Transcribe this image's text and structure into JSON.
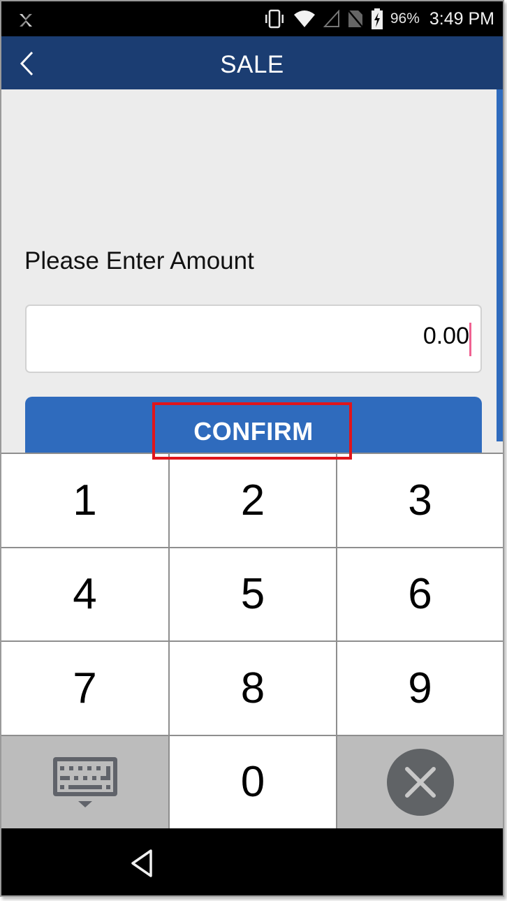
{
  "status_bar": {
    "app_icon": "app-logo-icon",
    "icons": [
      "vibrate-icon",
      "wifi-icon",
      "no-signal-icon",
      "no-sim-icon",
      "battery-charging-icon"
    ],
    "battery_percent": "96%",
    "time": "3:49 PM"
  },
  "header": {
    "back_icon": "chevron-left-icon",
    "title": "SALE"
  },
  "form": {
    "prompt": "Please Enter Amount",
    "amount_value": "0.00",
    "confirm_label": "CONFIRM"
  },
  "keypad": {
    "keys": [
      "1",
      "2",
      "3",
      "4",
      "5",
      "6",
      "7",
      "8",
      "9"
    ],
    "zero": "0",
    "left_icon": "keyboard-hide-icon",
    "right_icon": "clear-icon"
  },
  "nav_bar": {
    "back_icon": "nav-back-icon"
  },
  "colors": {
    "header": "#1b3d72",
    "accent": "#2f6bbd",
    "cursor": "#f06292",
    "highlight": "#e0151b"
  }
}
